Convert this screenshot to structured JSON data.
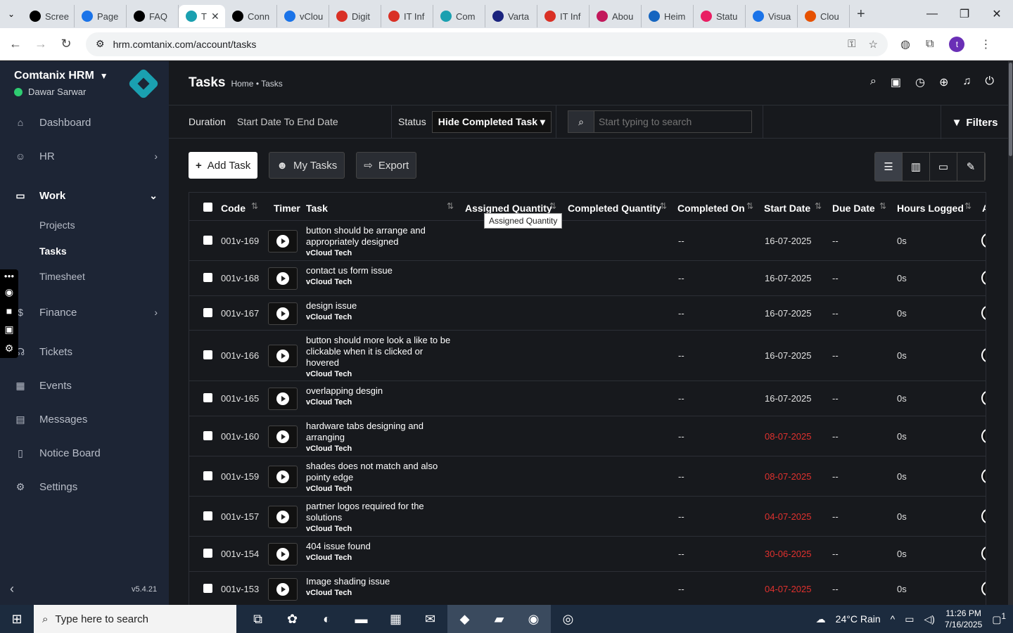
{
  "browser": {
    "tabs": [
      {
        "label": "Scree",
        "color": "#000000"
      },
      {
        "label": "Page",
        "color": "#1a73e8"
      },
      {
        "label": "FAQ",
        "color": "#000000"
      },
      {
        "label": "T",
        "color": "#1aa0b0",
        "active": true
      },
      {
        "label": "Conn",
        "color": "#000000"
      },
      {
        "label": "vClou",
        "color": "#1a73e8"
      },
      {
        "label": "Digit",
        "color": "#d93025"
      },
      {
        "label": "IT Inf",
        "color": "#d93025"
      },
      {
        "label": "Com",
        "color": "#1aa0b0"
      },
      {
        "label": "Varta",
        "color": "#1a237e"
      },
      {
        "label": "IT Inf",
        "color": "#d93025"
      },
      {
        "label": "Abou",
        "color": "#c2185b"
      },
      {
        "label": "Heim",
        "color": "#1565c0"
      },
      {
        "label": "Statu",
        "color": "#e91e63"
      },
      {
        "label": "Visua",
        "color": "#1a73e8"
      },
      {
        "label": "Clou",
        "color": "#e65100"
      }
    ],
    "url": "hrm.comtanix.com/account/tasks"
  },
  "sidebar": {
    "company": "Comtanix HRM",
    "user": "Dawar Sarwar",
    "menu": {
      "dashboard": "Dashboard",
      "hr": "HR",
      "work": "Work",
      "projects": "Projects",
      "tasks": "Tasks",
      "timesheet": "Timesheet",
      "finance": "Finance",
      "tickets": "Tickets",
      "events": "Events",
      "messages": "Messages",
      "notice_board": "Notice Board",
      "settings": "Settings"
    },
    "version": "v5.4.21"
  },
  "header": {
    "title": "Tasks",
    "breadcrumb": "Home • Tasks"
  },
  "filters": {
    "duration_label": "Duration",
    "duration_value": "Start Date To End Date",
    "status_label": "Status",
    "status_value": "Hide Completed Task",
    "search_placeholder": "Start typing to search",
    "filters_button": "Filters"
  },
  "actions": {
    "add_task": "Add Task",
    "my_tasks": "My Tasks",
    "export": "Export"
  },
  "table": {
    "columns": {
      "code": "Code",
      "timer": "Timer",
      "task": "Task",
      "assigned_qty": "Assigned Quantity",
      "completed_qty": "Completed Quantity",
      "completed_on": "Completed On",
      "start_date": "Start Date",
      "due_date": "Due Date",
      "hours_logged": "Hours Logged",
      "extra": "A"
    },
    "tooltip": "Assigned Quantity",
    "rows": [
      {
        "code": "001v-169",
        "task": "button should be arrange and appropriately designed",
        "project": "vCloud Tech",
        "completed_on": "--",
        "start_date": "16-07-2025",
        "overdue": false,
        "due_date": "--",
        "hours": "0s"
      },
      {
        "code": "001v-168",
        "task": "contact us form issue",
        "project": "vCloud Tech",
        "completed_on": "--",
        "start_date": "16-07-2025",
        "overdue": false,
        "due_date": "--",
        "hours": "0s"
      },
      {
        "code": "001v-167",
        "task": "design issue",
        "project": "vCloud Tech",
        "completed_on": "--",
        "start_date": "16-07-2025",
        "overdue": false,
        "due_date": "--",
        "hours": "0s"
      },
      {
        "code": "001v-166",
        "task": "button should more look a like to be clickable when it is clicked or hovered",
        "project": "vCloud Tech",
        "completed_on": "--",
        "start_date": "16-07-2025",
        "overdue": false,
        "due_date": "--",
        "hours": "0s"
      },
      {
        "code": "001v-165",
        "task": "overlapping desgin",
        "project": "vCloud Tech",
        "completed_on": "--",
        "start_date": "16-07-2025",
        "overdue": false,
        "due_date": "--",
        "hours": "0s"
      },
      {
        "code": "001v-160",
        "task": "hardware tabs designing and arranging",
        "project": "vCloud Tech",
        "completed_on": "--",
        "start_date": "08-07-2025",
        "overdue": true,
        "due_date": "--",
        "hours": "0s"
      },
      {
        "code": "001v-159",
        "task": "shades does not match and also pointy edge",
        "project": "vCloud Tech",
        "completed_on": "--",
        "start_date": "08-07-2025",
        "overdue": true,
        "due_date": "--",
        "hours": "0s"
      },
      {
        "code": "001v-157",
        "task": "partner logos required for the solutions",
        "project": "vCloud Tech",
        "completed_on": "--",
        "start_date": "04-07-2025",
        "overdue": true,
        "due_date": "--",
        "hours": "0s"
      },
      {
        "code": "001v-154",
        "task": "404 issue found",
        "project": "vCloud Tech",
        "completed_on": "--",
        "start_date": "30-06-2025",
        "overdue": true,
        "due_date": "--",
        "hours": "0s"
      },
      {
        "code": "001v-153",
        "task": "Image shading issue",
        "project": "vCloud Tech",
        "completed_on": "--",
        "start_date": "04-07-2025",
        "overdue": true,
        "due_date": "--",
        "hours": "0s"
      }
    ]
  },
  "taskbar": {
    "search_placeholder": "Type here to search",
    "weather": "24°C Rain",
    "time": "11:26 PM",
    "date": "7/16/2025",
    "notification_count": "1"
  },
  "colors": {
    "sidebar_bg": "#1d2535",
    "main_bg": "#17191d",
    "overdue": "#e0312e",
    "accent": "#1aa0b0"
  }
}
